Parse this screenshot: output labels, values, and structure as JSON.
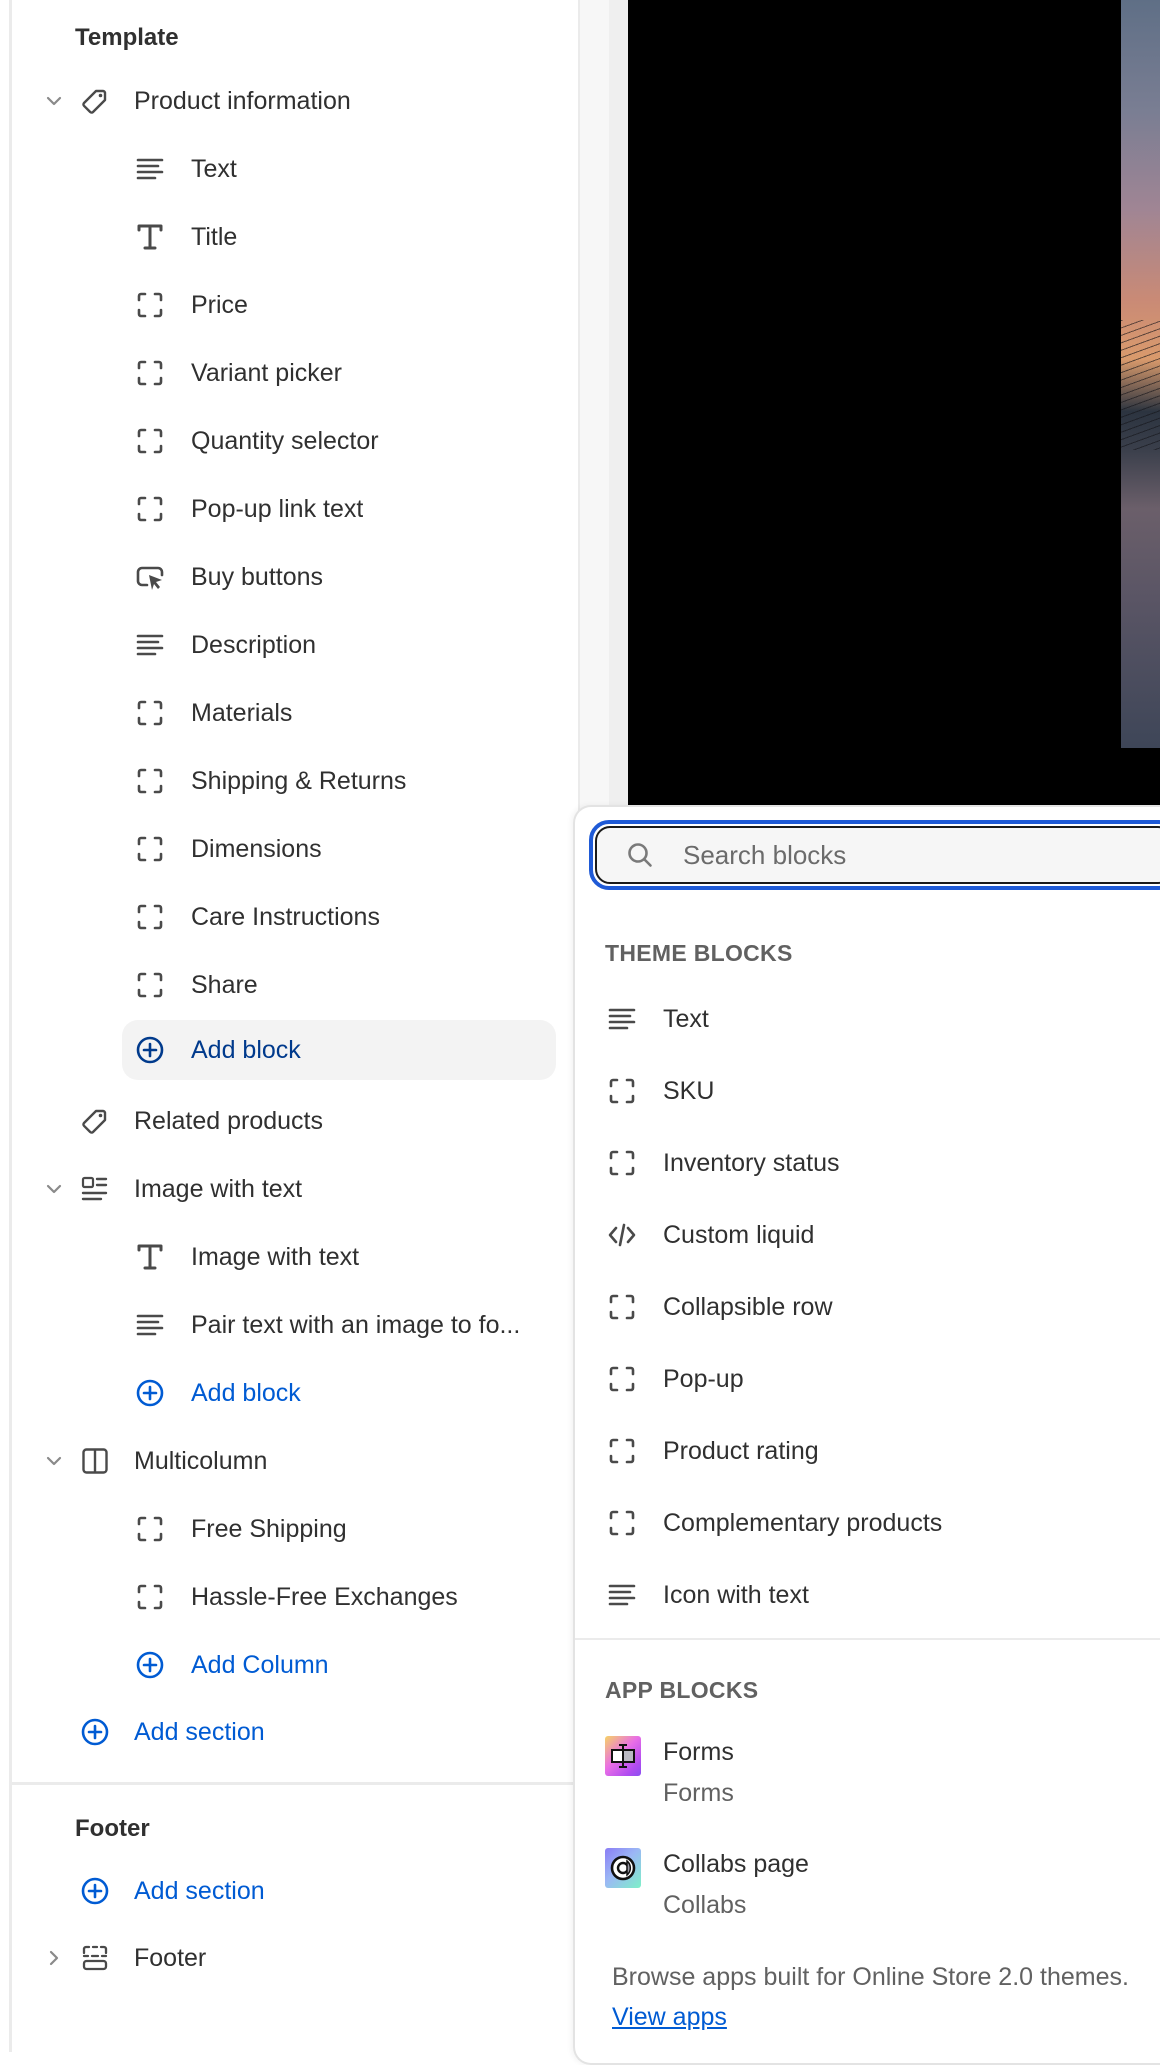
{
  "sidebar": {
    "template_heading": "Template",
    "sections": [
      {
        "label": "Product information",
        "icon": "tag-icon",
        "expanded": true,
        "blocks": [
          {
            "label": "Text",
            "icon": "text-lines-icon"
          },
          {
            "label": "Title",
            "icon": "text-title-icon"
          },
          {
            "label": "Price",
            "icon": "block-placeholder-icon"
          },
          {
            "label": "Variant picker",
            "icon": "block-placeholder-icon"
          },
          {
            "label": "Quantity selector",
            "icon": "block-placeholder-icon"
          },
          {
            "label": "Pop-up link text",
            "icon": "block-placeholder-icon"
          },
          {
            "label": "Buy buttons",
            "icon": "button-cursor-icon"
          },
          {
            "label": "Description",
            "icon": "text-lines-icon"
          },
          {
            "label": "Materials",
            "icon": "block-placeholder-icon"
          },
          {
            "label": "Shipping & Returns",
            "icon": "block-placeholder-icon"
          },
          {
            "label": "Dimensions",
            "icon": "block-placeholder-icon"
          },
          {
            "label": "Care Instructions",
            "icon": "block-placeholder-icon"
          },
          {
            "label": "Share",
            "icon": "block-placeholder-icon"
          }
        ],
        "add_label": "Add block"
      },
      {
        "label": "Related products",
        "icon": "tag-icon",
        "expanded": false
      },
      {
        "label": "Image with text",
        "icon": "image-with-text-icon",
        "expanded": true,
        "blocks": [
          {
            "label": "Image with text",
            "icon": "text-title-icon"
          },
          {
            "label": "Pair text with an image to fo...",
            "icon": "text-lines-icon"
          }
        ],
        "add_label": "Add block"
      },
      {
        "label": "Multicolumn",
        "icon": "columns-icon",
        "expanded": true,
        "blocks": [
          {
            "label": "Free Shipping",
            "icon": "block-placeholder-icon"
          },
          {
            "label": "Hassle-Free Exchanges",
            "icon": "block-placeholder-icon"
          }
        ],
        "add_label": "Add Column"
      }
    ],
    "add_section_label": "Add section",
    "footer_heading": "Footer",
    "footer_add_section_label": "Add section",
    "footer_section": {
      "label": "Footer",
      "icon": "footer-layout-icon",
      "expanded": false
    }
  },
  "popover": {
    "search_placeholder": "Search blocks",
    "search_value": "",
    "theme_blocks_heading": "THEME BLOCKS",
    "theme_blocks": [
      {
        "label": "Text",
        "icon": "text-lines-icon"
      },
      {
        "label": "SKU",
        "icon": "block-placeholder-icon"
      },
      {
        "label": "Inventory status",
        "icon": "block-placeholder-icon"
      },
      {
        "label": "Custom liquid",
        "icon": "code-icon"
      },
      {
        "label": "Collapsible row",
        "icon": "block-placeholder-icon"
      },
      {
        "label": "Pop-up",
        "icon": "block-placeholder-icon"
      },
      {
        "label": "Product rating",
        "icon": "block-placeholder-icon"
      },
      {
        "label": "Complementary products",
        "icon": "block-placeholder-icon"
      },
      {
        "label": "Icon with text",
        "icon": "text-lines-icon"
      }
    ],
    "app_blocks_heading": "APP BLOCKS",
    "app_blocks": [
      {
        "title": "Forms",
        "app": "Forms",
        "icon": "forms-app-icon"
      },
      {
        "title": "Collabs page",
        "app": "Collabs",
        "icon": "collabs-app-icon"
      }
    ],
    "browse_text": "Browse apps built for Online Store 2.0 themes.",
    "browse_link": "View apps"
  },
  "colors": {
    "accent_link": "#005bd3",
    "focus_ring": "#1f5ad6",
    "text_primary": "#303030",
    "text_secondary": "#616161"
  }
}
